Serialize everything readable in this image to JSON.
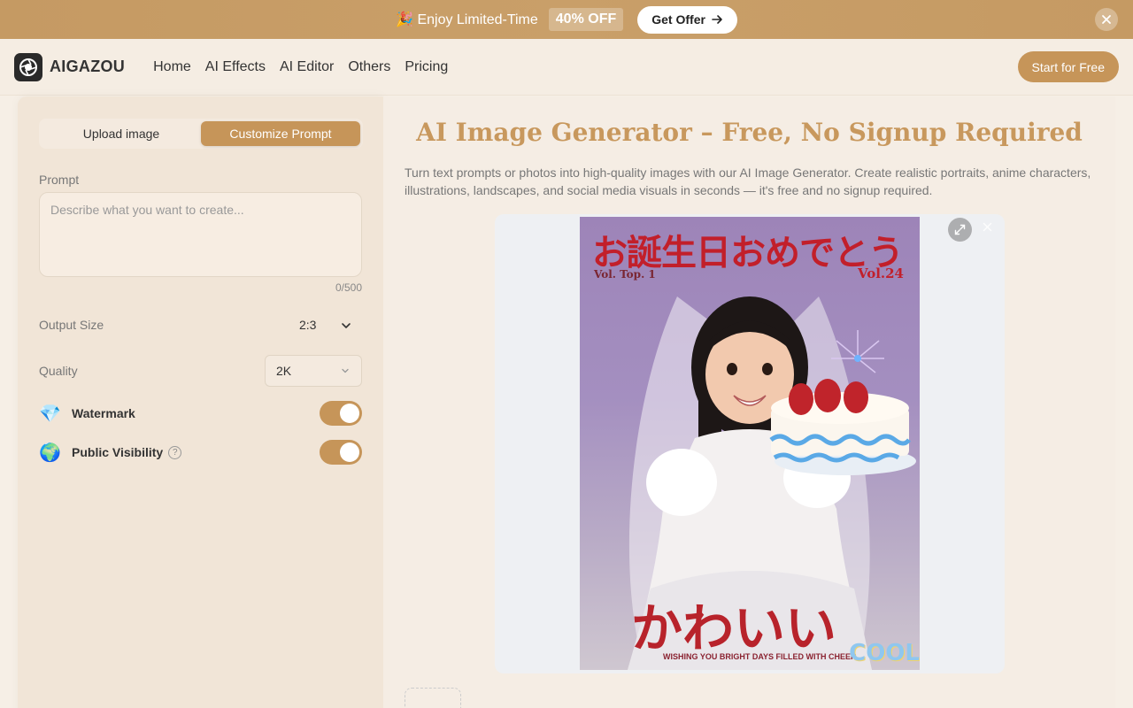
{
  "promo": {
    "emoji": "🎉",
    "text": "Enjoy Limited-Time",
    "badge": "40% OFF",
    "cta": "Get Offer"
  },
  "nav": {
    "brand": "AIGAZOU",
    "links": [
      "Home",
      "AI Effects",
      "AI Editor",
      "Others",
      "Pricing"
    ],
    "cta": "Start for Free"
  },
  "panel": {
    "tabs": [
      "Upload image",
      "Customize Prompt"
    ],
    "active_tab": "Customize Prompt",
    "prompt_label": "Prompt",
    "prompt_placeholder": "Describe what you want to create...",
    "prompt_value": "",
    "counter": "0/500",
    "output_size_label": "Output Size",
    "output_size_value": "2:3",
    "quality_label": "Quality",
    "quality_value": "2K",
    "watermark_label": "Watermark",
    "watermark_icon": "💎",
    "watermark_on": true,
    "visibility_label": "Public Visibility",
    "visibility_icon": "🌍",
    "visibility_help": "?",
    "visibility_on": true
  },
  "main": {
    "title": "AI Image Generator – Free, No Signup Required",
    "description": "Turn text prompts or photos into high-quality images with our AI Image Generator. Create realistic portraits, anime characters, illustrations, landscapes, and social media visuals in seconds — it's free and no signup required."
  },
  "poster": {
    "headline": "お誕生日おめでとう",
    "vol_left": "Vol. Top. 1",
    "vol_right": "Vol.24",
    "bottom_text": "かわいい",
    "caption": "WISHING YOU BRIGHT DAYS FILLED WITH CHEER",
    "sticker": "COOL"
  },
  "colors": {
    "accent": "#c69559",
    "title": "#c8985d",
    "promo": "#c59a63"
  }
}
